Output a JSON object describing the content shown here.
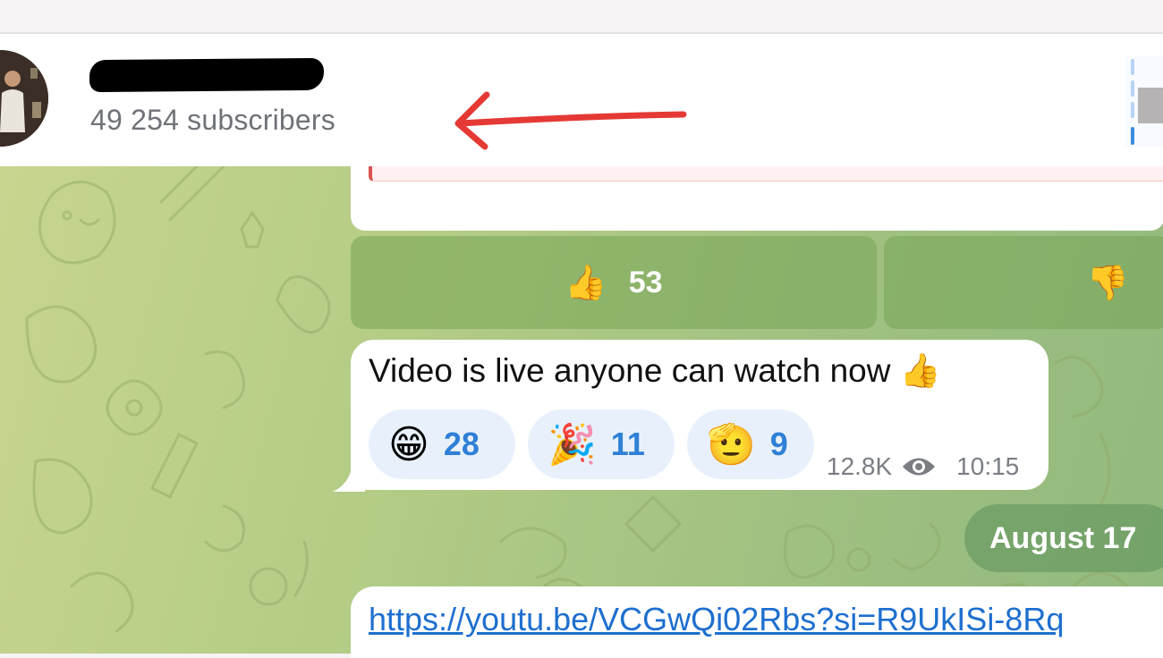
{
  "header": {
    "subscribers": "49 254 subscribers"
  },
  "inline_buttons": [
    {
      "emoji": "👍",
      "count": "53",
      "icon": "thumbs-up-icon"
    },
    {
      "emoji": "👎",
      "count": "",
      "icon": "thumbs-down-icon"
    }
  ],
  "message": {
    "text": "Video is live anyone can watch now 👍",
    "reactions": [
      {
        "emoji": "😁",
        "count": "28",
        "icon": "grinning-face-icon"
      },
      {
        "emoji": "🎉",
        "count": "11",
        "icon": "party-popper-icon"
      },
      {
        "emoji": "🫡",
        "count": "9",
        "icon": "saluting-face-icon"
      }
    ],
    "views": "12.8K",
    "time": "10:15"
  },
  "date_separator": "August 17",
  "link_message": {
    "text": "https://youtu.be/VCGwQi02Rbs?si=R9UkISi-8Rq"
  },
  "colors": {
    "accent_blue": "#2f80d6",
    "annotation_arrow": "#e53935",
    "chat_background": "#b4cc86"
  }
}
